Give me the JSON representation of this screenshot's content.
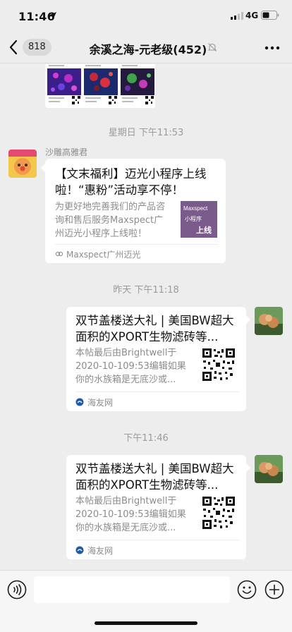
{
  "status_bar": {
    "time": "11:46",
    "network": "4G"
  },
  "nav": {
    "unread_count": "818",
    "title": "余溪之海-元老级(452)"
  },
  "timestamps": [
    "星期日 下午11:53",
    "昨天 下午11:18",
    "下午11:46"
  ],
  "messages": [
    {
      "sender": "沙雕高雅君",
      "title": "【文末福利】迈光小程序上线啦！“惠粉”活动享不停！",
      "description": "为更好地完善我们的产品咨询和售后服务Maxspect广州迈光小程序上线啦！",
      "thumbnail_text": [
        "Maxspect",
        "小程序",
        "上线"
      ],
      "source": "Maxspect广州迈光"
    },
    {
      "title": "双节盖楼送大礼 | 美国BW超大面积的XPORT生物滤砖等...",
      "description": "本帖最后由Brightwell于2020-10-109:53编辑如果你的水族箱是无底沙或...",
      "source": "海友网"
    },
    {
      "title": "双节盖楼送大礼 | 美国BW超大面积的XPORT生物滤砖等...",
      "description": "本帖最后由Brightwell于2020-10-109:53编辑如果你的水族箱是无底沙或...",
      "source": "海友网"
    }
  ],
  "icons": {
    "back": "chevron-left-icon",
    "mute": "mute-bell-icon",
    "more": "more-dots-icon",
    "voice": "voice-icon",
    "emoji": "emoji-icon",
    "plus": "plus-icon"
  },
  "colors": {
    "background": "#ededed",
    "card": "#ffffff",
    "muted_text": "#8c8c8c",
    "thumbnail_purple": "#7b5b8c"
  }
}
